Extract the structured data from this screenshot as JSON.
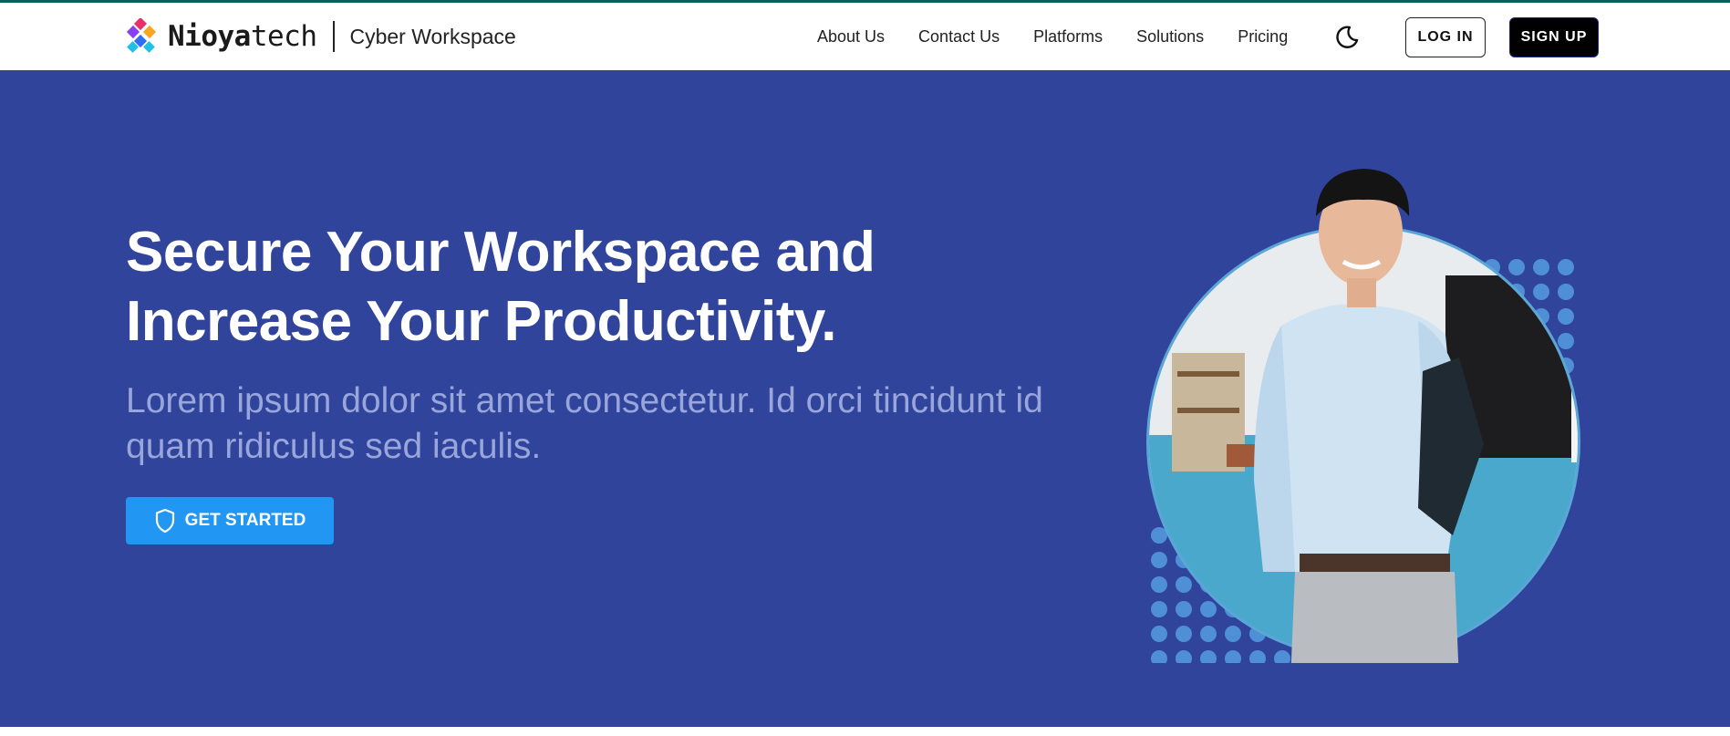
{
  "brand": {
    "name_bold": "Nioya",
    "name_light": "tech",
    "subtitle": "Cyber Workspace",
    "logo_icon": "nioyatech-logo-icon"
  },
  "nav": {
    "items": [
      {
        "label": "About Us"
      },
      {
        "label": "Contact Us"
      },
      {
        "label": "Platforms"
      },
      {
        "label": "Solutions"
      },
      {
        "label": "Pricing"
      }
    ],
    "theme_toggle_icon": "moon-icon",
    "login_label": "LOG IN",
    "signup_label": "SIGN UP"
  },
  "hero": {
    "title": "Secure Your Workspace and Increase Your Productivity.",
    "subtitle": "Lorem ipsum dolor sit amet consectetur. Id orci tincidunt id quam ridiculus sed iaculis.",
    "cta_label": "GET STARTED",
    "cta_icon": "shield-icon",
    "image_subject": "smiling-businessman-holding-folder"
  },
  "colors": {
    "hero_bg": "#31449b",
    "hero_subtitle": "#98a6dc",
    "cta_bg": "#2196f3",
    "accent_top_line": "#0b5e5a",
    "dot_pattern": "#4f8fd6",
    "circle_bg": "#4aa8cc"
  }
}
